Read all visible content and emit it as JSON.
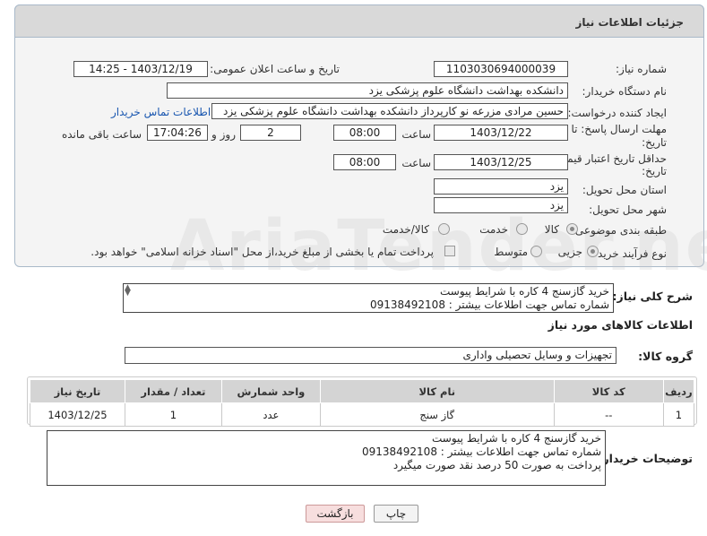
{
  "header": {
    "title": "جزئیات اطلاعات نیاز"
  },
  "form": {
    "need_number_label": "شماره نیاز:",
    "need_number": "1103030694000039",
    "announce_label": "تاریخ و ساعت اعلان عمومی:",
    "announce_value": "1403/12/19 - 14:25",
    "buyer_org_label": "نام دستگاه خریدار:",
    "buyer_org": "دانشکده بهداشت دانشگاه علوم پزشکی یزد",
    "creator_label": "ایجاد کننده درخواست:",
    "creator": "حسین مرادی مزرعه نو کارپرداز دانشکده بهداشت دانشگاه علوم پزشکی یزد",
    "contact_link": "اطلاعات تماس خریدار",
    "reply_deadline_label_1": "مهلت ارسال پاسخ: تا",
    "reply_deadline_label_2": "تاریخ:",
    "reply_date": "1403/12/22",
    "time_label": "ساعت",
    "reply_time": "08:00",
    "days_value": "2",
    "days_label": "روز و",
    "remaining_time": "17:04:26",
    "remaining_label": "ساعت باقی مانده",
    "price_validity_label_1": "حداقل تاریخ اعتبار قیمت: تا",
    "price_validity_label_2": "تاریخ:",
    "price_date": "1403/12/25",
    "price_time": "08:00",
    "province_label": "استان محل تحویل:",
    "province": "یزد",
    "city_label": "شهر محل تحویل:",
    "city": "یزد",
    "category_label": "طبقه بندی موضوعی:",
    "category_options": [
      "کالا",
      "خدمت",
      "کالا/خدمت"
    ],
    "category_selected": "کالا",
    "process_label": "نوع فرآیند خرید :",
    "process_options": [
      "جزیی",
      "متوسط"
    ],
    "process_selected": "جزیی",
    "payment_note": "پرداخت تمام یا بخشی از مبلغ خرید،از محل \"اسناد خزانه اسلامی\" خواهد بود."
  },
  "description": {
    "label": "شرح کلی نیاز:",
    "line1": "خرید گازسنج 4 کاره با شرایط پیوست",
    "line2": "شماره تماس جهت اطلاعات بیشتر : 09138492108"
  },
  "goods_info_title": "اطلاعات کالاهای مورد نیاز",
  "goods_group": {
    "label": "گروه کالا:",
    "value": "تجهیزات و وسایل تحصیلی واداری"
  },
  "table": {
    "headers": [
      "ردیف",
      "کد کالا",
      "نام کالا",
      "واحد شمارش",
      "تعداد / مقدار",
      "تاریخ نیاز"
    ],
    "rows": [
      [
        "1",
        "--",
        "گاز سنج",
        "عدد",
        "1",
        "1403/12/25"
      ]
    ]
  },
  "buyer_notes": {
    "label": "توضیحات خریدار:",
    "line1": "خرید گازسنج 4 کاره با شرایط پیوست",
    "line2": "شماره تماس جهت اطلاعات بیشتر : 09138492108",
    "line3": "پرداخت به صورت 50 درصد نقد صورت میگیرد"
  },
  "buttons": {
    "print": "چاپ",
    "back": "بازگشت"
  },
  "watermark": "AriaTender.neT",
  "colors": {
    "link": "#1a57b0",
    "back_button_bg": "#f7dede"
  }
}
